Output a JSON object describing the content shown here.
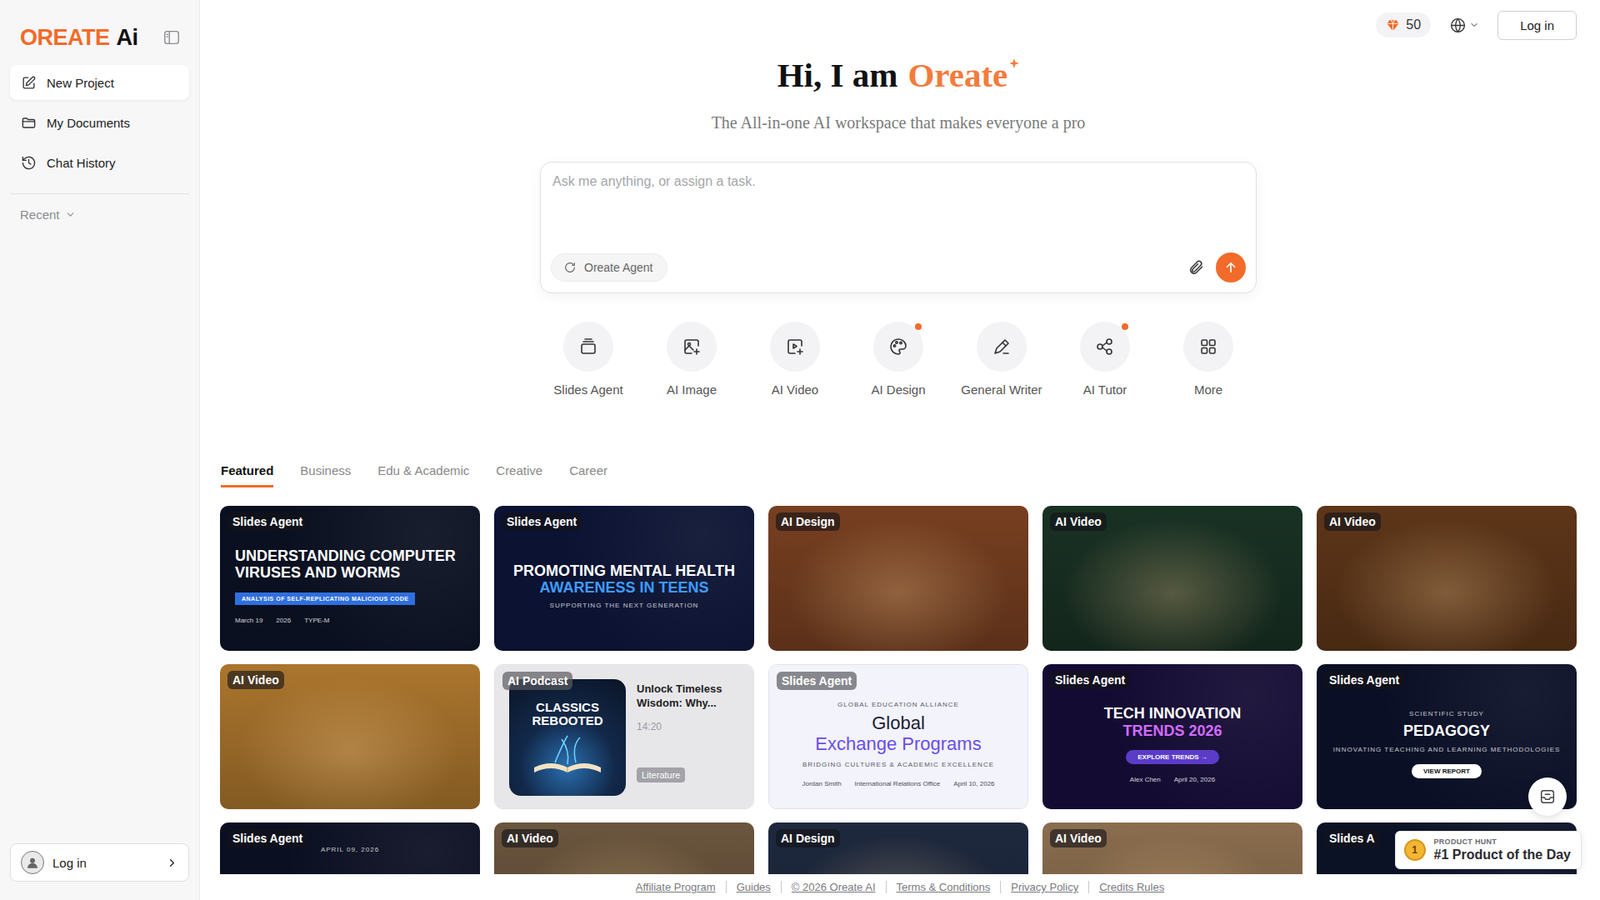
{
  "sidebar": {
    "logo": {
      "main": "OREATE",
      "suffix": "Ai"
    },
    "items": [
      {
        "label": "New Project",
        "selected": true
      },
      {
        "label": "My Documents",
        "selected": false
      },
      {
        "label": "Chat History",
        "selected": false
      }
    ],
    "recent": "Recent",
    "login": "Log in"
  },
  "topbar": {
    "credits": "50",
    "login": "Log in"
  },
  "hero": {
    "greeting": "Hi, I am",
    "brand": "Oreate",
    "subtitle": "The All-in-one AI workspace that makes everyone a pro"
  },
  "composer": {
    "placeholder": "Ask me anything, or assign a task.",
    "mode": "Oreate Agent"
  },
  "tools": [
    {
      "label": "Slides Agent",
      "new": false
    },
    {
      "label": "AI Image",
      "new": false
    },
    {
      "label": "AI Video",
      "new": false
    },
    {
      "label": "AI Design",
      "new": true
    },
    {
      "label": "General Writer",
      "new": false
    },
    {
      "label": "AI Tutor",
      "new": true
    },
    {
      "label": "More",
      "new": false
    }
  ],
  "tabs": [
    {
      "label": "Featured",
      "selected": true
    },
    {
      "label": "Business",
      "selected": false
    },
    {
      "label": "Edu & Academic",
      "selected": false
    },
    {
      "label": "Creative",
      "selected": false
    },
    {
      "label": "Career",
      "selected": false
    }
  ],
  "cards": [
    {
      "tag": "Slides Agent",
      "kind": "slide-left",
      "color": "#0a1020",
      "texts": [
        {
          "kind": "title",
          "text": "UNDERSTANDING COMPUTER VIRUSES AND WORMS"
        },
        {
          "kind": "chip",
          "text": "ANALYSIS OF SELF-REPLICATING MALICIOUS CODE",
          "color": "#2f6fe0"
        },
        {
          "kind": "meta",
          "text": "March 19"
        },
        {
          "kind": "meta",
          "text": "2026"
        },
        {
          "kind": "meta",
          "text": "TYPE-M"
        }
      ]
    },
    {
      "tag": "Slides Agent",
      "kind": "slide",
      "color": "#0b1232",
      "texts": [
        {
          "kind": "title",
          "text": "PROMOTING MENTAL HEALTH"
        },
        {
          "kind": "accent",
          "text": "AWARENESS IN TEENS",
          "color": "#3d9cff"
        },
        {
          "kind": "sub",
          "text": "SUPPORTING THE NEXT GENERATION"
        }
      ]
    },
    {
      "tag": "AI Design",
      "kind": "photo",
      "color": "#8c4a26"
    },
    {
      "tag": "AI Video",
      "kind": "photo",
      "color": "#1d3a2a"
    },
    {
      "tag": "AI Video",
      "kind": "photo",
      "color": "#6e3f1d"
    },
    {
      "tag": "AI Video",
      "kind": "photo",
      "color": "#c98a35"
    },
    {
      "tag": "AI Podcast",
      "kind": "podcast",
      "art": "CLASSICS REBOOTED",
      "title": "Unlock Timeless Wisdom: Why...",
      "duration": "14:20",
      "category": "Literature"
    },
    {
      "tag": "Slides Agent",
      "kind": "slide-light",
      "color": "#f2f3fb",
      "texts": [
        {
          "kind": "eyebrow",
          "text": "GLOBAL EDUCATION ALLIANCE"
        },
        {
          "kind": "title",
          "text": "Global"
        },
        {
          "kind": "accent",
          "text": "Exchange Programs",
          "color": "#6a4de8"
        },
        {
          "kind": "sub",
          "text": "BRIDGING CULTURES & ACADEMIC EXCELLENCE"
        },
        {
          "kind": "meta",
          "text": "Jordan Smith"
        },
        {
          "kind": "meta",
          "text": "International Relations Office"
        },
        {
          "kind": "meta",
          "text": "April 10, 2026"
        }
      ]
    },
    {
      "tag": "Slides Agent",
      "kind": "slide",
      "color": "#140b33",
      "texts": [
        {
          "kind": "title",
          "text": "TECH INNOVATION"
        },
        {
          "kind": "accent",
          "text": "TRENDS 2026",
          "color": "#d26bff"
        },
        {
          "kind": "button",
          "text": "EXPLORE TRENDS →",
          "color": "#5a3cc8"
        },
        {
          "kind": "meta",
          "text": "Alex Chen"
        },
        {
          "kind": "meta",
          "text": "April 20, 2026"
        }
      ]
    },
    {
      "tag": "Slides Agent",
      "kind": "slide",
      "color": "#0a0f26",
      "texts": [
        {
          "kind": "eyebrow",
          "text": "SCIENTIFIC STUDY"
        },
        {
          "kind": "title",
          "text": "PEDAGOGY"
        },
        {
          "kind": "sub",
          "text": "INNOVATING TEACHING AND LEARNING METHODOLOGIES"
        },
        {
          "kind": "button",
          "text": "VIEW REPORT",
          "color": "#ffffff"
        }
      ]
    },
    {
      "tag": "Slides Agent",
      "kind": "slide-top",
      "color": "#0b0f22",
      "texts": [
        {
          "kind": "eyebrow",
          "text": "APRIL 09, 2026"
        }
      ]
    },
    {
      "tag": "AI Video",
      "kind": "photo",
      "color": "#7d6448"
    },
    {
      "tag": "AI Design",
      "kind": "photo",
      "color": "#233049"
    },
    {
      "tag": "AI Video",
      "kind": "photo",
      "color": "#a3805c"
    },
    {
      "tag": "Slides A",
      "kind": "slide-top",
      "color": "#0c1226",
      "texts": []
    }
  ],
  "footer": {
    "links": [
      "Affiliate Program",
      "Guides",
      "© 2026 Oreate AI",
      "Terms & Conditions",
      "Privacy Policy",
      "Credits Rules"
    ]
  },
  "badge": {
    "rank": "1",
    "eyebrow": "PRODUCT HUNT",
    "title": "#1 Product of the Day"
  }
}
